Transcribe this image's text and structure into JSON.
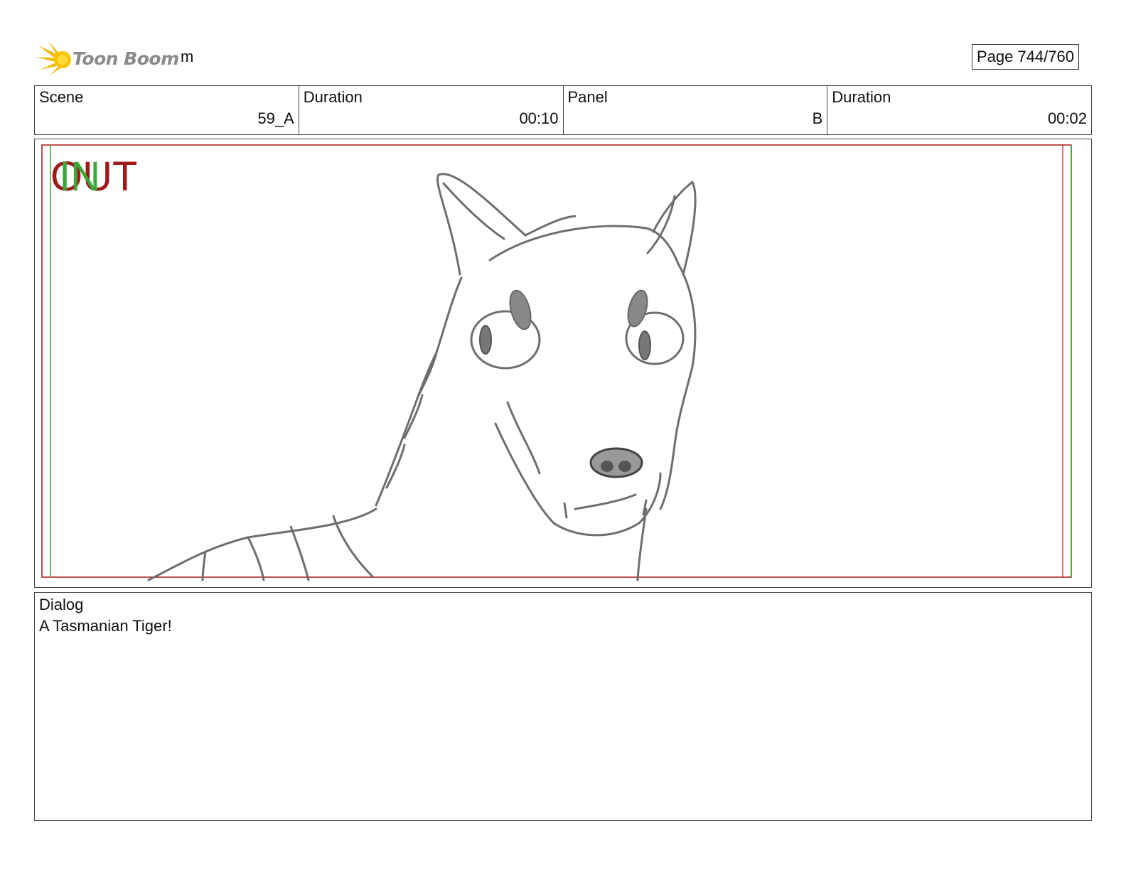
{
  "header": {
    "logo_text": "Toon Boom",
    "project_name": "m",
    "page": "Page 744/760"
  },
  "info": {
    "scene_label": "Scene",
    "scene_value": "59_A",
    "scene_duration_label": "Duration",
    "scene_duration_value": "00:10",
    "panel_label": "Panel",
    "panel_value": "B",
    "panel_duration_label": "Duration",
    "panel_duration_value": "00:02"
  },
  "panel_frame": {
    "out_label": "OUT",
    "in_label": "IN",
    "out_color": "#a01818",
    "in_color": "#3aa83a",
    "sketch_subject": "tasmanian-tiger-sketch"
  },
  "dialog": {
    "label": "Dialog",
    "text": "A Tasmanian Tiger!"
  }
}
